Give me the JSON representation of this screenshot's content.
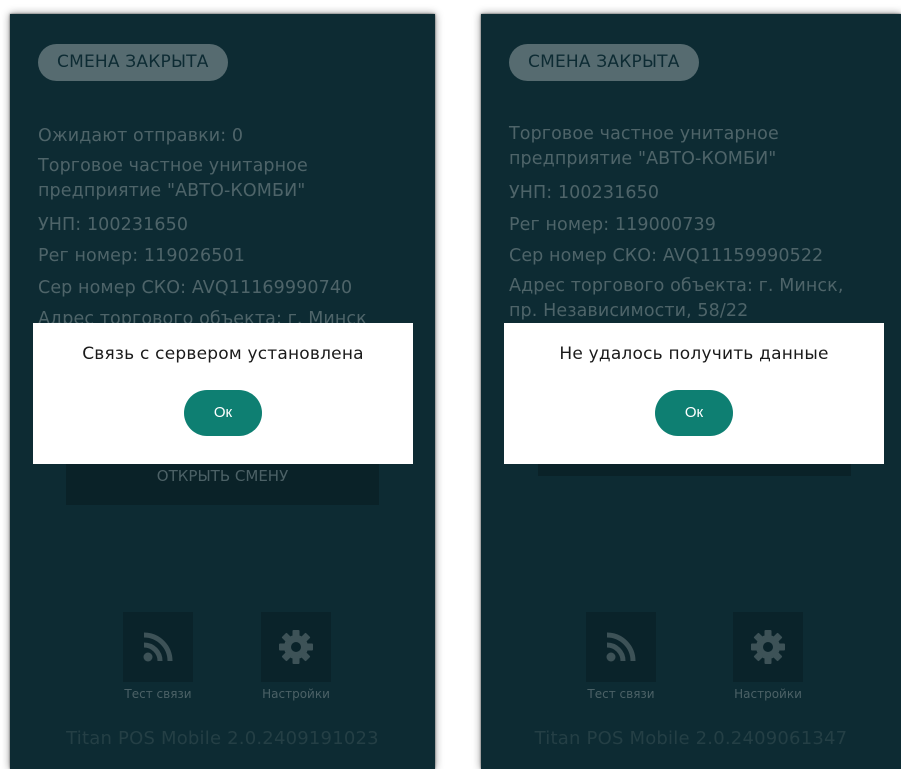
{
  "phones": [
    {
      "shift_status": "СМЕНА ЗАКРЫТА",
      "info": {
        "pending": "Ожидают отправки: 0",
        "company_line1": "Торговое частное унитарное",
        "company_line2": "предприятие \"АВТО-КОМБИ\"",
        "unp": "УНП: 100231650",
        "reg_number": "Рег номер: 119026501",
        "sko_number": "Сер номер СКО: AVQ11169990740",
        "address": "Адрес торгового объекта: г. Минск"
      },
      "open_shift_label": "ОТКРЫТЬ СМЕНУ",
      "tools": {
        "test_label": "Тест связи",
        "settings_label": "Настройки"
      },
      "version": "Titan POS Mobile 2.0.2409191023",
      "dialog": {
        "message": "Связь с сервером установлена",
        "ok_label": "Ок"
      }
    },
    {
      "shift_status": "СМЕНА ЗАКРЫТА",
      "info": {
        "company_line1": "Торговое частное унитарное",
        "company_line2": "предприятие \"АВТО-КОМБИ\"",
        "unp": "УНП: 100231650",
        "reg_number": "Рег номер: 119000739",
        "sko_number": "Сер номер СКО: AVQ11159990522",
        "address_line1": "Адрес торгового объекта: г. Минск,",
        "address_line2": "пр. Независимости, 58/22"
      },
      "tools": {
        "test_label": "Тест связи",
        "settings_label": "Настройки"
      },
      "version": "Titan POS Mobile 2.0.2409061347",
      "dialog": {
        "message": "Не удалось получить данные",
        "ok_label": "Ок"
      }
    }
  ],
  "icons": {
    "test": "rss-signal-icon",
    "settings": "gear-icon"
  },
  "colors": {
    "background": "#0d2b33",
    "accent": "#0e7f72",
    "dialog": "#ffffff"
  }
}
